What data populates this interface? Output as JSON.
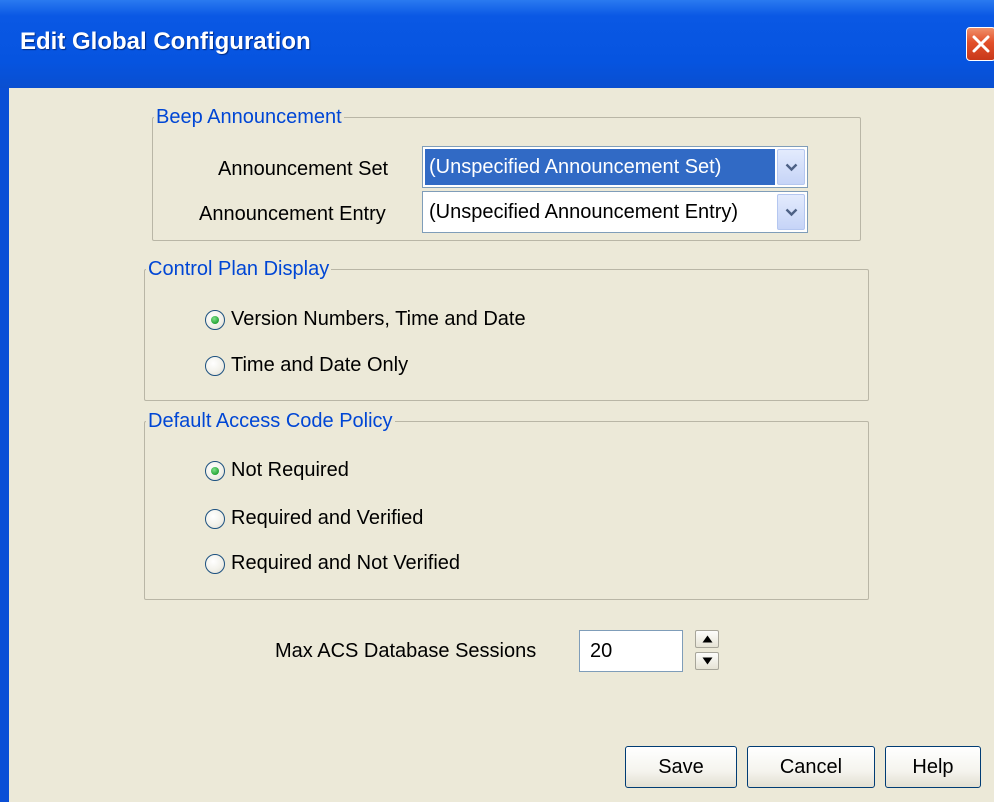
{
  "window": {
    "title": "Edit Global Configuration"
  },
  "beep_announcement": {
    "legend": "Beep Announcement",
    "set_label": "Announcement Set",
    "set_value": "(Unspecified Announcement Set)",
    "entry_label": "Announcement Entry",
    "entry_value": "(Unspecified Announcement Entry)"
  },
  "control_plan_display": {
    "legend": "Control Plan Display",
    "options": [
      {
        "label": "Version Numbers, Time and Date",
        "selected": true
      },
      {
        "label": "Time and Date Only",
        "selected": false
      }
    ]
  },
  "access_code_policy": {
    "legend": "Default Access Code Policy",
    "options": [
      {
        "label": "Not Required",
        "selected": true
      },
      {
        "label": "Required and Verified",
        "selected": false
      },
      {
        "label": "Required and Not Verified",
        "selected": false
      }
    ]
  },
  "max_sessions": {
    "label": "Max ACS Database Sessions",
    "value": "20"
  },
  "buttons": {
    "save": "Save",
    "cancel": "Cancel",
    "help": "Help"
  },
  "colors": {
    "titlebar": "#0654e0",
    "dialog_bg": "#ece9d8",
    "legend_text": "#0046d5",
    "selection": "#316ac5",
    "radio_dot": "#26a536"
  }
}
